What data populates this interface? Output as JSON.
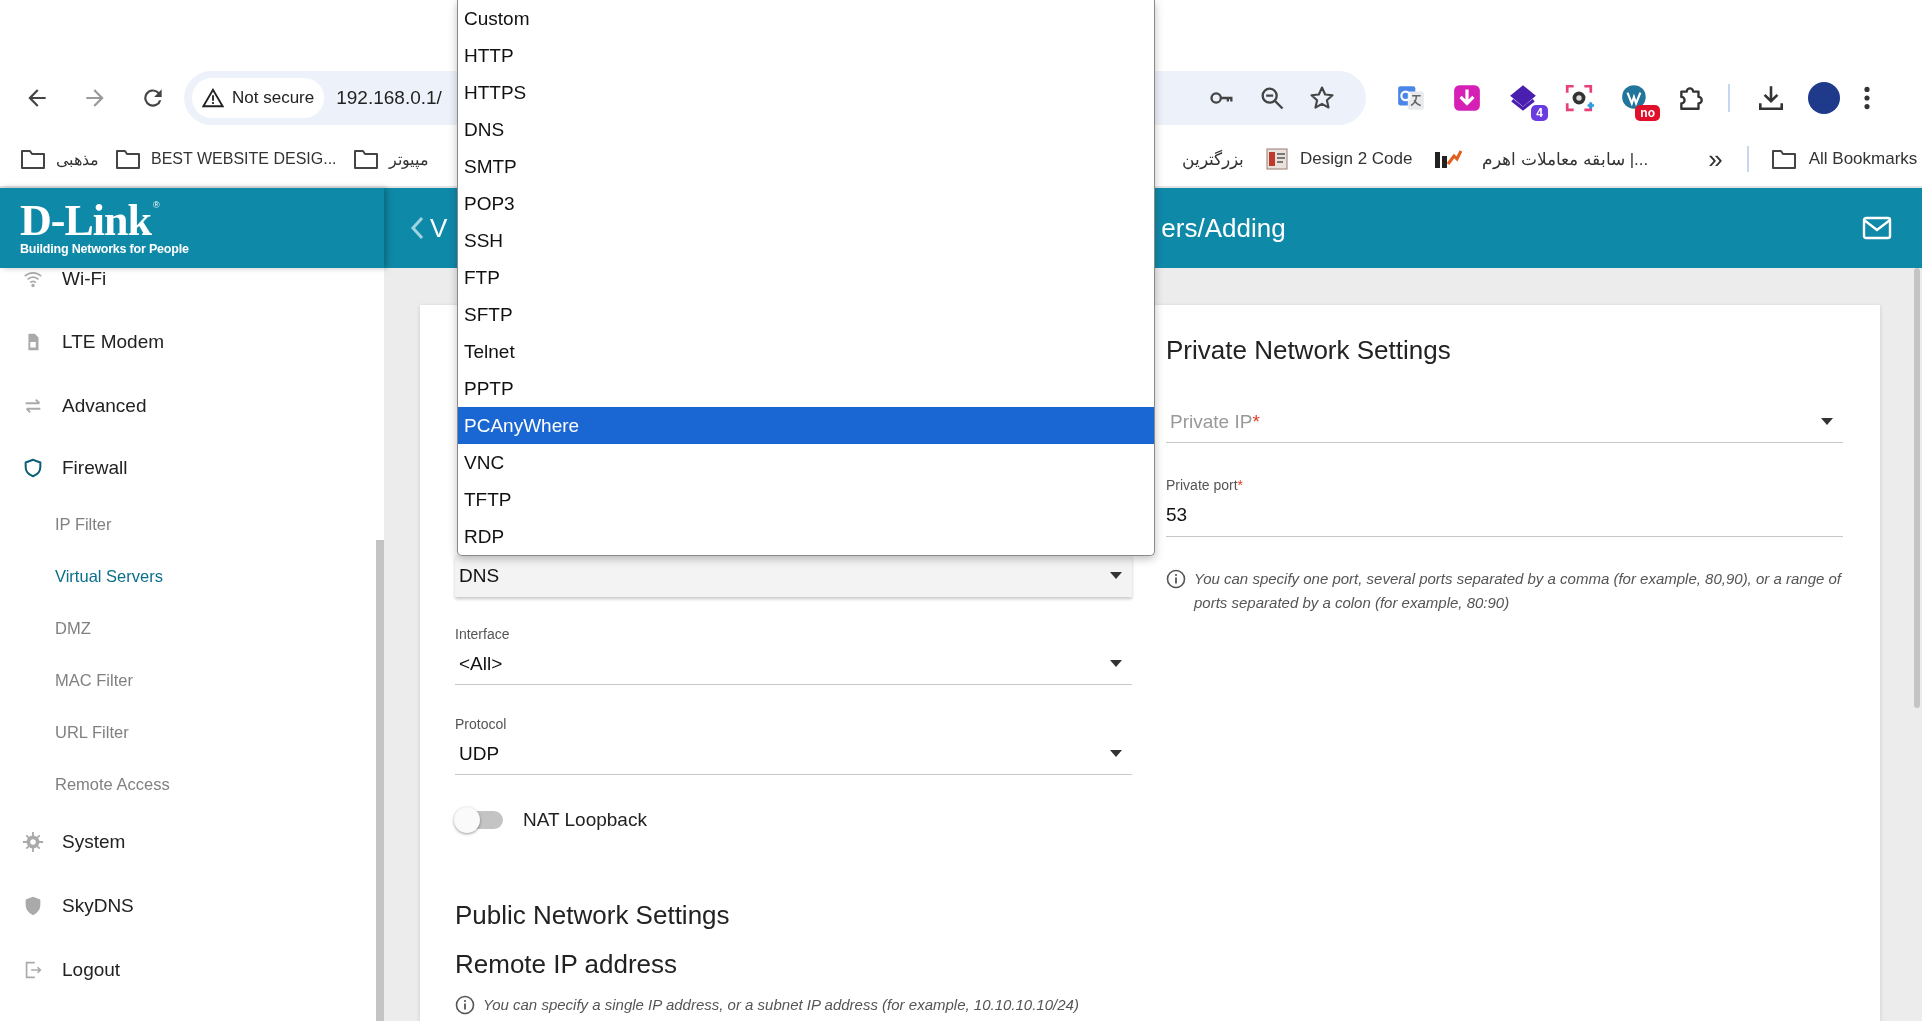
{
  "browser": {
    "security_chip": "Not secure",
    "url": "192.168.0.1/",
    "extensions": [
      {
        "kind": "translate"
      },
      {
        "kind": "download"
      },
      {
        "kind": "layers",
        "badge": "4"
      },
      {
        "kind": "capture"
      },
      {
        "kind": "wp",
        "badge": "no"
      },
      {
        "kind": "puzzle"
      }
    ],
    "bookmarks_left": {
      "first": {
        "kind": "folder",
        "label": "مذهبی"
      },
      "second": {
        "kind": "folder",
        "label": "BEST WEBSITE DESIG..."
      },
      "third": {
        "kind": "folder",
        "label": "مپیوتر"
      }
    },
    "bookmarks_right": {
      "first": {
        "label": "بزرگترین"
      },
      "second": {
        "kind": "page",
        "label": "Design 2 Code"
      },
      "third": {
        "kind": "chart",
        "label": "سابقه معاملات اهرم |..."
      }
    },
    "more": "»",
    "all_bookmarks": "All Bookmarks"
  },
  "header": {
    "logo": "D-Link",
    "logo_mark": "®",
    "tagline": "Building Networks for People",
    "title_start": "V",
    "title_end": "ers/Adding"
  },
  "sidebar": {
    "items": [
      {
        "label": "Wi-Fi",
        "selected": false
      },
      {
        "label": "LTE Modem",
        "selected": false
      },
      {
        "label": "Advanced",
        "selected": false
      },
      {
        "label": "Firewall",
        "selected": true,
        "children": [
          {
            "label": "IP Filter",
            "selected": false
          },
          {
            "label": "Virtual Servers",
            "selected": true
          },
          {
            "label": "DMZ",
            "selected": false
          },
          {
            "label": "MAC Filter",
            "selected": false
          },
          {
            "label": "URL Filter",
            "selected": false
          },
          {
            "label": "Remote Access",
            "selected": false
          }
        ]
      },
      {
        "label": "System",
        "selected": false
      },
      {
        "label": "SkyDNS",
        "selected": false
      },
      {
        "label": "Logout",
        "selected": false
      }
    ]
  },
  "form": {
    "template": {
      "value": "DNS"
    },
    "interface": {
      "label": "Interface",
      "value": "<All>"
    },
    "protocol": {
      "label": "Protocol",
      "value": "UDP"
    },
    "nat_loopback": {
      "label": "NAT Loopback",
      "on": false
    },
    "public_heading": "Public Network Settings",
    "remote_heading": "Remote IP address",
    "remote_hint": "You can specify a single IP address, or a subnet IP address (for example, 10.10.10.10/24)",
    "private_heading": "Private Network Settings",
    "private_ip": {
      "placeholder": "Private IP",
      "mark": "*"
    },
    "private_port": {
      "label": "Private port",
      "mark": "*",
      "value": "53"
    },
    "port_hint": "You can specify one port, several ports separated by a comma (for example, 80,90), or a range of ports separated by a colon (for example, 80:90)"
  },
  "dropdown": {
    "options": [
      {
        "label": "Custom",
        "selected": false
      },
      {
        "label": "HTTP",
        "selected": false
      },
      {
        "label": "HTTPS",
        "selected": false
      },
      {
        "label": "DNS",
        "selected": false
      },
      {
        "label": "SMTP",
        "selected": false
      },
      {
        "label": "POP3",
        "selected": false
      },
      {
        "label": "SSH",
        "selected": false
      },
      {
        "label": "FTP",
        "selected": false
      },
      {
        "label": "SFTP",
        "selected": false
      },
      {
        "label": "Telnet",
        "selected": false
      },
      {
        "label": "PPTP",
        "selected": false
      },
      {
        "label": "PCAnyWhere",
        "selected": true
      },
      {
        "label": "VNC",
        "selected": false
      },
      {
        "label": "TFTP",
        "selected": false
      },
      {
        "label": "RDP",
        "selected": false
      }
    ]
  }
}
